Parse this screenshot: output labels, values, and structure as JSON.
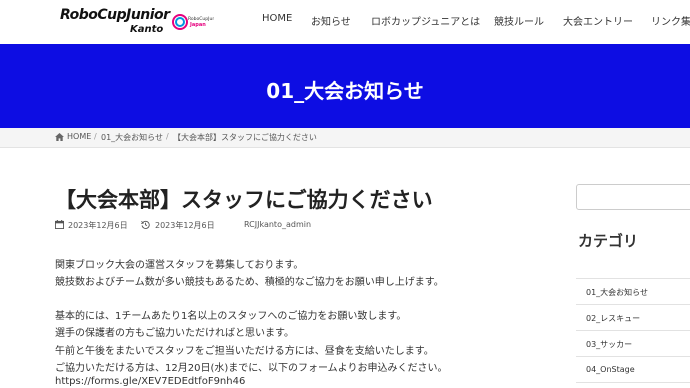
{
  "logo": {
    "main": "RoboCupJunior",
    "sub": "Kanto",
    "mark_text": "RoboCupJunior Japan"
  },
  "nav": [
    "HOME",
    "お知らせ",
    "ロボカップジュニアとは",
    "競技ルール",
    "大会エントリー",
    "リンク集"
  ],
  "hero": {
    "title": "01_大会お知らせ"
  },
  "breadcrumb": {
    "home": "HOME",
    "category": "01_大会お知らせ",
    "current": "【大会本部】スタッフにご協力ください"
  },
  "post": {
    "title": "【大会本部】スタッフにご協力ください",
    "published": "2023年12月6日",
    "updated": "2023年12月6日",
    "author": "RCJJkanto_admin",
    "paragraphs": [
      "関東ブロック大会の運営スタッフを募集しております。",
      "競技数およびチーム数が多い競技もあるため、積極的なご協力をお願い申し上げます。",
      "基本的には、1チームあたり1名以上のスタッフへのご協力をお願い致します。",
      "選手の保護者の方もご協力いただければと思います。",
      "午前と午後をまたいでスタッフをご担当いただける方には、昼食を支給いたします。",
      "ご協力いただける方は、12月20日(水)までに、以下のフォームよりお申込みください。",
      "https://forms.gle/XEV7EDEdtfoF9nh46"
    ]
  },
  "sidebar": {
    "search_placeholder": "",
    "heading": "カテゴリ",
    "categories": [
      "01_大会お知らせ",
      "02_レスキュー",
      "03_サッカー",
      "04_OnStage"
    ]
  },
  "colors": {
    "hero_bg": "#0d0de3",
    "text": "#333333"
  }
}
